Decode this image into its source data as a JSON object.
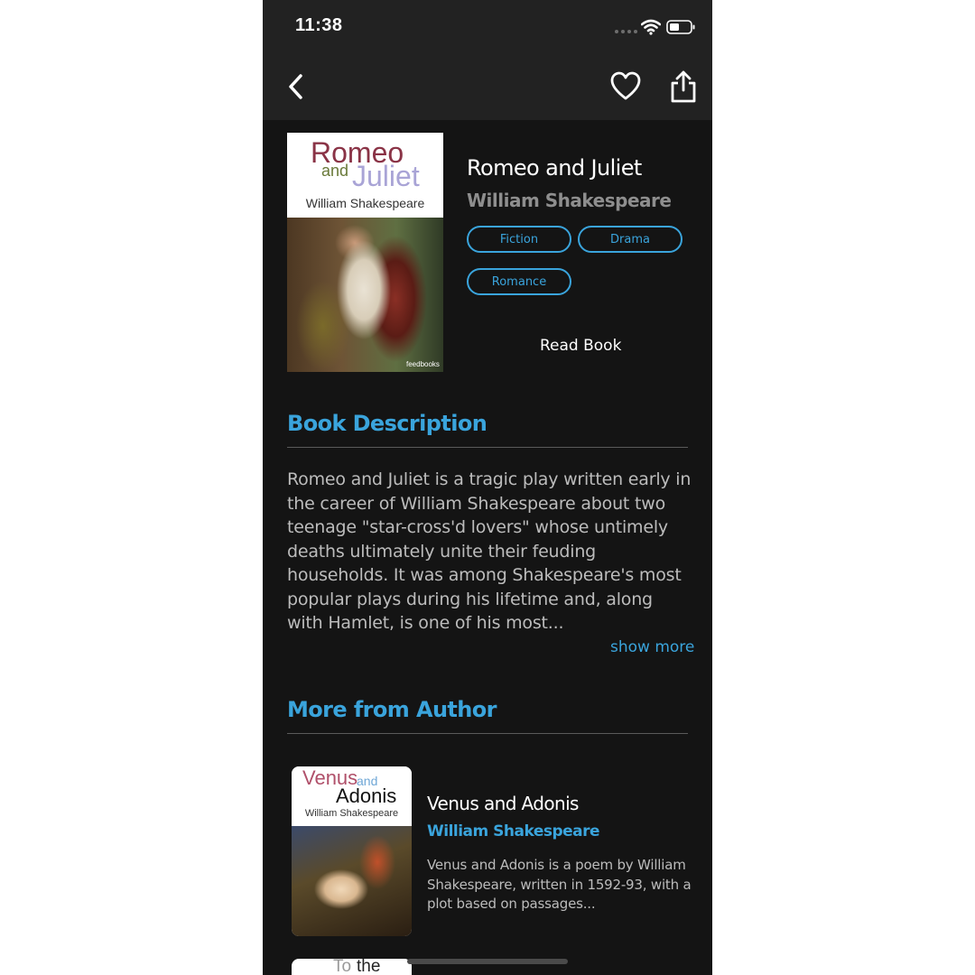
{
  "status_bar": {
    "time": "11:38"
  },
  "nav": {
    "back_icon": "chevron-left-icon",
    "favorite_icon": "heart-icon",
    "share_icon": "share-icon"
  },
  "book": {
    "cover": {
      "title_line1": "Romeo",
      "title_and": "and",
      "title_line2": "Juliet",
      "author": "William Shakespeare",
      "publisher_logo": "feedbooks"
    },
    "title": "Romeo and Juliet",
    "author": "William Shakespeare",
    "tags": [
      "Fiction",
      "Drama",
      "Romance"
    ],
    "read_label": "Read Book"
  },
  "description": {
    "heading": "Book Description",
    "text": "Romeo and Juliet is a tragic play written early in the career of William Shakespeare about two teenage \"star-cross'd lovers\" whose untimely deaths ultimately unite their feuding households. It was among Shakespeare's most popular plays during his lifetime and, along with Hamlet, is one of his most...",
    "show_more": "show more"
  },
  "more_from_author": {
    "heading": "More from Author",
    "items": [
      {
        "cover_word1": "Venus",
        "cover_and": "and",
        "cover_word2": "Adonis",
        "cover_author": "William Shakespeare",
        "title": "Venus and Adonis",
        "author": "William Shakespeare",
        "description": "Venus and Adonis is a poem by William Shakespeare, written in 1592-93, with a plot based on passages..."
      },
      {
        "cover_word1": "To",
        "cover_word2": "the"
      }
    ]
  },
  "colors": {
    "accent": "#3aa4dc",
    "background": "#141414",
    "header": "#222222"
  }
}
